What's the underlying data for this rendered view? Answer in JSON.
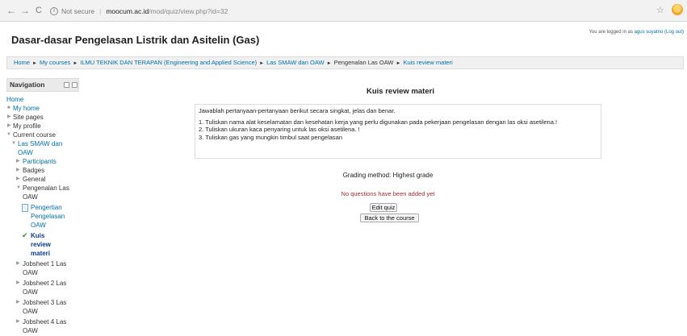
{
  "browser": {
    "back": "←",
    "forward": "→",
    "reload": "C",
    "info": "i",
    "security": "Not secure",
    "separator": "|",
    "host": "moocum.ac.id",
    "path": "/mod/quiz/view.php?id=32",
    "star": "☆"
  },
  "header": {
    "title": "Dasar-dasar Pengelasan Listrik dan Asitelin (Gas)",
    "login_prefix": "You are logged in as ",
    "user": "agus suyatno",
    "logout": "(Log out)"
  },
  "breadcrumb": [
    "Home",
    "My courses",
    "ILMU TEKNIK DAN TERAPAN (Engineering and Applied Science)",
    "Las SMAW dan OAW",
    "Pengenalan Las OAW",
    "Kuis review materi"
  ],
  "breadcrumb_sep": "►",
  "navigation": {
    "title": "Navigation",
    "items": [
      "Home",
      "My home",
      "Site pages",
      "My profile",
      "Current course",
      "Las SMAW dan OAW",
      "Participants",
      "Badges",
      "General",
      "Pengenalan Las OAW",
      "Pengertian Pengelasan OAW",
      "Kuis review materi",
      "Jobsheet 1 Las OAW",
      "Jobsheet 2 Las OAW",
      "Jobsheet 3 Las OAW",
      "Jobsheet 4 Las OAW"
    ]
  },
  "quiz": {
    "title": "Kuis review materi",
    "intro": "Jawablah pertanyaan-pertanyaan berikut secara singkat, jelas dan benar.",
    "questions": [
      "1. Tuliskan nama alat keselamatan dan kesehatan kerja yang perlu digunakan pada pekerjaan pengelasan dengan las oksi asetilena.!",
      "2. Tuliskan ukuran kaca penyaring untuk las oksi asetilena. !",
      "3. Tuliskan gas yang mungkin timbul saat pengelasan"
    ],
    "grading": "Grading method: Highest grade",
    "no_questions": "No questions have been added yet",
    "edit_button": "Edit quiz",
    "back_button": "Back to the course"
  }
}
